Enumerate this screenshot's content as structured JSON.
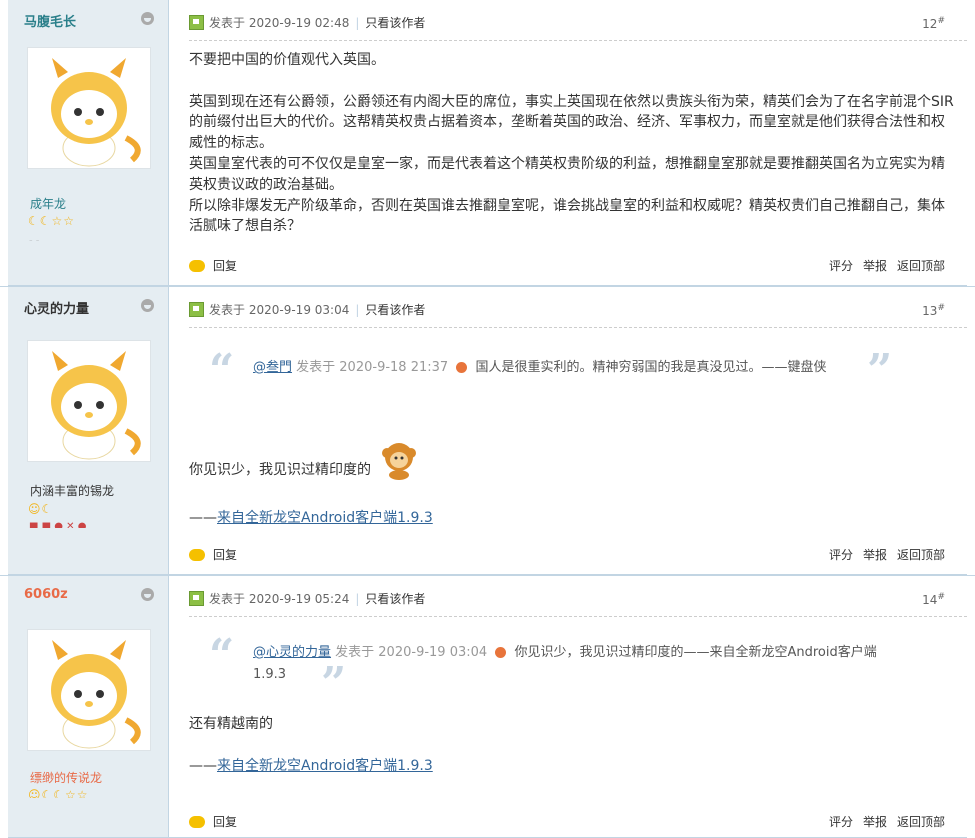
{
  "posts": [
    {
      "username": "马腹毛长",
      "rank": "成年龙",
      "rank_stars": "☾☾☆☆",
      "posted_label": "发表于",
      "datetime": "2020-9-19 02:48",
      "only_author": "只看该作者",
      "floor": "12",
      "floor_mark": "#",
      "content": [
        "不要把中国的价值观代入英国。",
        "",
        "英国到现在还有公爵领，公爵领还有内阁大臣的席位，事实上英国现在依然以贵族头衔为荣，精英们会为了在名字前混个SIR的前缀付出巨大的代价。这帮精英权贵占据着资本，垄断着英国的政治、经济、军事权力，而皇室就是他们获得合法性和权威性的标志。",
        "英国皇室代表的可不仅仅是皇室一家，而是代表着这个精英权贵阶级的利益，想推翻皇室那就是要推翻英国名为立宪实为精英权贵议政的政治基础。",
        "所以除非爆发无产阶级革命，否则在英国谁去推翻皇室呢，谁会挑战皇室的利益和权威呢？精英权贵们自己推翻自己，集体活腻味了想自杀？"
      ],
      "reply": "回复",
      "rate": "评分",
      "report": "举报",
      "top": "返回顶部"
    },
    {
      "username": "心灵的力量",
      "rank": "内涵丰富的锡龙",
      "rank_stars": "☺☾",
      "posted_label": "发表于",
      "datetime": "2020-9-19 03:04",
      "only_author": "只看该作者",
      "floor": "13",
      "floor_mark": "#",
      "quote_user": "@叁門",
      "quote_posted": "发表于 2020-9-18 21:37",
      "quote_text": "国人是很重实利的。精神穷弱国的我是真没见过。——键盘侠",
      "body": "你见识少，我见识过精印度的",
      "signature_prefix": "——",
      "signature_link": "来自全新龙空Android客户端1.9.3",
      "reply": "回复",
      "rate": "评分",
      "report": "举报",
      "top": "返回顶部"
    },
    {
      "username": "6060z",
      "rank": "缥缈的传说龙",
      "rank_stars": "☺☾☾☆☆",
      "posted_label": "发表于",
      "datetime": "2020-9-19 05:24",
      "only_author": "只看该作者",
      "floor": "14",
      "floor_mark": "#",
      "quote_user": "@心灵的力量",
      "quote_posted": "发表于 2020-9-19 03:04",
      "quote_text": "你见识少，我见识过精印度的——来自全新龙空Android客户端1.9.3",
      "body": "还有精越南的",
      "signature_prefix": "——",
      "signature_link": "来自全新龙空Android客户端1.9.3",
      "reply": "回复",
      "rate": "评分",
      "report": "举报",
      "top": "返回顶部"
    }
  ],
  "colors": {
    "sidebar_bg": "#e5edf2",
    "border": "#c2d5e3",
    "link": "#336699",
    "rank3": "#e86a47"
  },
  "icons": {
    "avatar": "dragon-cartoon-avatar",
    "online": "user-online-icon",
    "reply": "reply-bubble-icon",
    "quote": "quote-mark-icon",
    "emoticon": "monkey-emoticon"
  }
}
